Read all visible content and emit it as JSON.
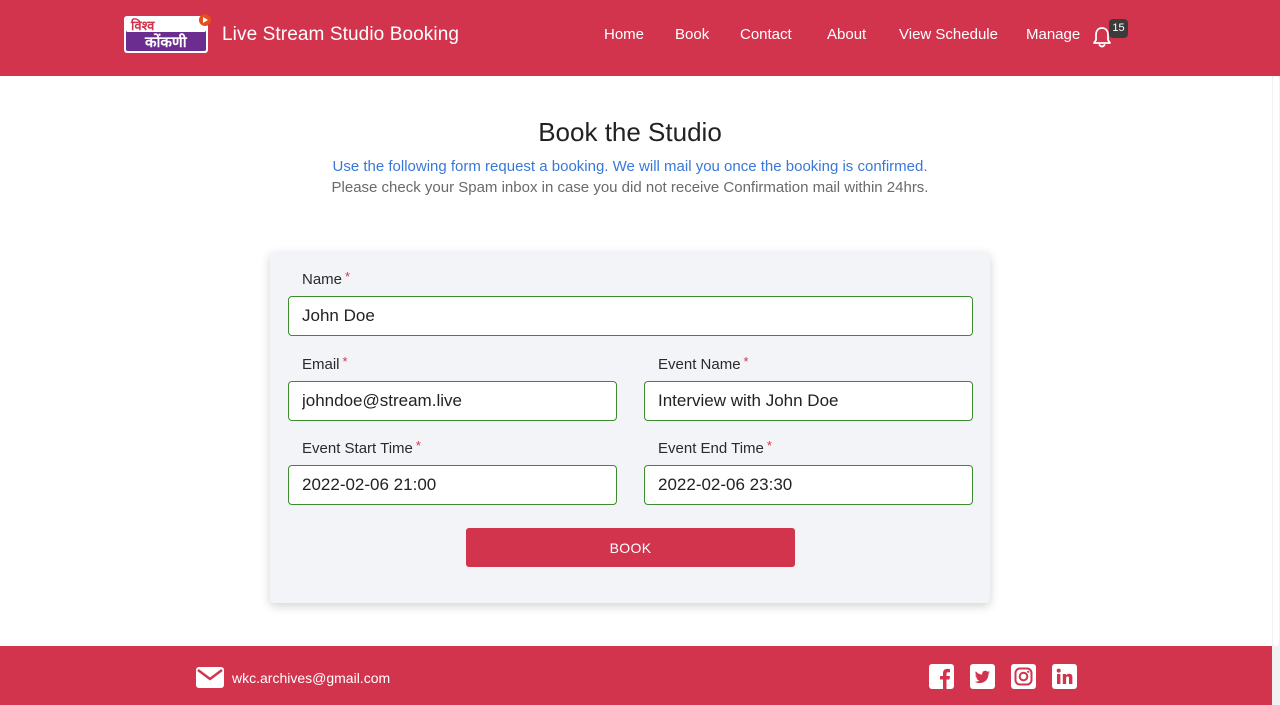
{
  "header": {
    "logo_text_top": "विश्व",
    "logo_text_bottom": "कोंकणी",
    "brand": "Live Stream Studio Booking",
    "nav": [
      "Home",
      "Book",
      "Contact",
      "About",
      "View Schedule",
      "Manage"
    ],
    "notification_count": "15"
  },
  "intro": {
    "title": "Book the Studio",
    "note_blue": "Use the following form request a booking. We will mail you once the booking is confirmed.",
    "note_grey": "Please check your Spam inbox in case you did not receive Confirmation mail within 24hrs."
  },
  "form": {
    "required_mark": "*",
    "name_label": "Name",
    "name_value": "John Doe",
    "email_label": "Email",
    "email_value": "johndoe@stream.live",
    "event_name_label": "Event Name",
    "event_name_value": "Interview with John Doe",
    "start_label": "Event Start Time",
    "start_value": "2022-02-06 21:00",
    "end_label": "Event End Time",
    "end_value": "2022-02-06 23:30",
    "submit_label": "BOOK"
  },
  "footer": {
    "email": "wkc.archives@gmail.com",
    "icons": [
      "mail-icon",
      "facebook-icon",
      "twitter-icon",
      "instagram-icon",
      "linkedin-icon"
    ]
  },
  "colors": {
    "brand": "#d2344d",
    "field_border": "#3d8b2f",
    "note_blue": "#3a78d8",
    "card_bg": "#f3f4f8"
  }
}
